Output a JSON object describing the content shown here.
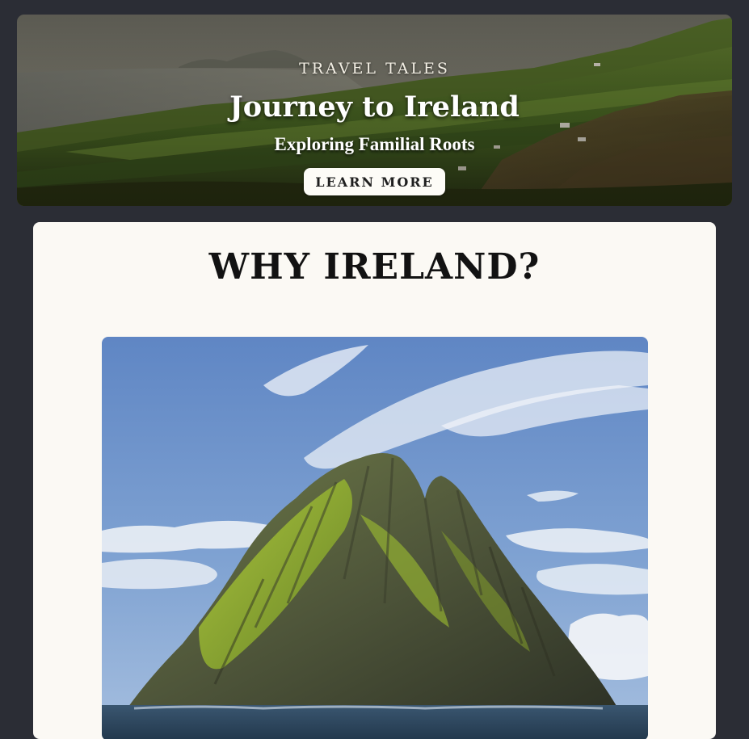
{
  "hero": {
    "eyebrow": "TRAVEL TALES",
    "title": "Journey to Ireland",
    "subtitle": "Exploring Familial Roots",
    "button_label": "LEARN MORE",
    "image": "irish-coastal-landscape"
  },
  "section": {
    "heading": "WHY IRELAND?",
    "image": "skellig-michael-island-photo"
  },
  "colors": {
    "page_background": "#2b2d35",
    "card_background": "#fbf9f4",
    "button_background": "#fdfcf7",
    "heading_text": "#121212",
    "hero_text": "#ffffff"
  }
}
